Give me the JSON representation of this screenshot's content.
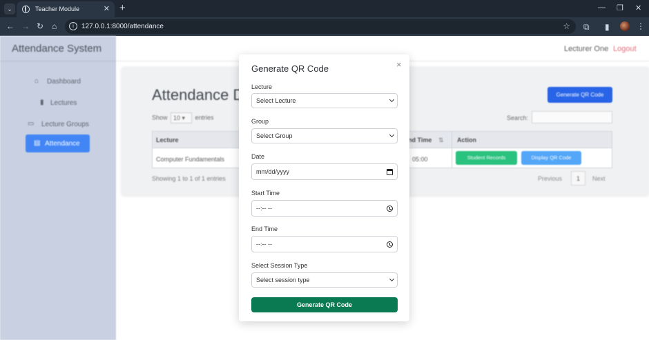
{
  "browser": {
    "tab_title": "Teacher Module",
    "tab_close": "✕",
    "new_tab": "+",
    "url": "127.0.0.1:8000/attendance",
    "window_controls": {
      "minimize": "—",
      "maximize": "❐",
      "close": "✕"
    }
  },
  "sidebar": {
    "brand": "Attendance System",
    "items": [
      {
        "label": "Dashboard",
        "icon": "home-icon",
        "active": false
      },
      {
        "label": "Lectures",
        "icon": "book-icon",
        "active": false
      },
      {
        "label": "Lecture Groups",
        "icon": "laptop-icon",
        "active": false
      },
      {
        "label": "Attendance",
        "icon": "clipboard-icon",
        "active": true
      }
    ]
  },
  "topnav": {
    "user_name": "Lecturer One",
    "logout_label": "Logout"
  },
  "main": {
    "heading": "Attendance D",
    "generate_button": "Generate QR Code",
    "show_label": "Show",
    "entries_value": "10",
    "entries_label": "entries",
    "search_label": "Search:",
    "table": {
      "columns": [
        "Lecture",
        "End Time",
        "Action"
      ],
      "rows": [
        {
          "lecture": "Computer Fundamentals",
          "end_time": "05:00",
          "actions": [
            "Student Records",
            "Display QR Code"
          ]
        }
      ]
    },
    "info": "Showing 1 to 1 of 1 entries",
    "pagination": {
      "prev": "Previous",
      "page": "1",
      "next": "Next"
    }
  },
  "modal": {
    "title": "Generate QR Code",
    "close": "×",
    "fields": {
      "lecture": {
        "label": "Lecture",
        "value": "Select Lecture"
      },
      "group": {
        "label": "Group",
        "value": "Select Group"
      },
      "date": {
        "label": "Date",
        "value": "mm/dd/yyyy"
      },
      "start_time": {
        "label": "Start Time",
        "value": "--:-- --"
      },
      "end_time": {
        "label": "End Time",
        "value": "--:-- --"
      },
      "session_type": {
        "label": "Select Session Type",
        "value": "Select session type"
      }
    },
    "submit_label": "Generate QR Code"
  },
  "colors": {
    "accent_blue": "#1f5ee6",
    "submit_green": "#0a7a52",
    "logout_red": "#e8677a",
    "chrome_dark": "#1f2732"
  }
}
